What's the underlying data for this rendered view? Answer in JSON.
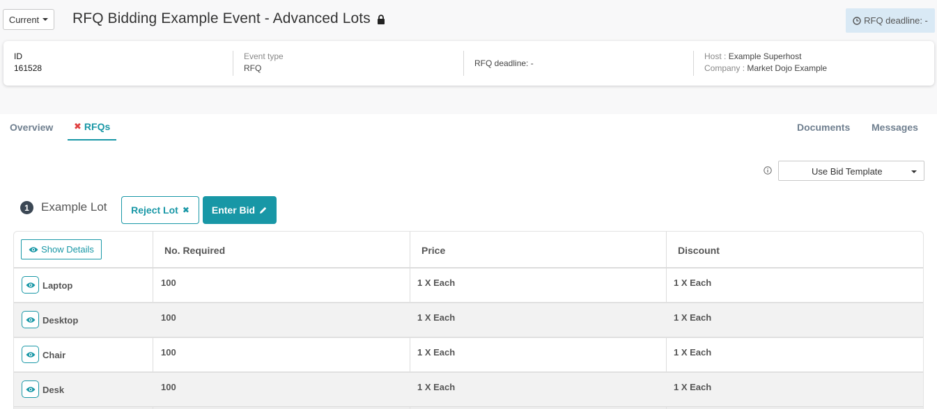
{
  "header": {
    "version_label": "Current",
    "event_title": "RFQ Bidding Example Event - Advanced Lots",
    "deadline_pill": "RFQ deadline: -"
  },
  "info": {
    "id_label": "ID",
    "id_value": "161528",
    "event_type_label": "Event type",
    "event_type_value": "RFQ",
    "deadline_text": "RFQ deadline: -",
    "host_label": "Host :",
    "host_value": "Example Superhost",
    "company_label": "Company :",
    "company_value": "Market Dojo Example"
  },
  "tabs": {
    "overview": "Overview",
    "rfqs": "RFQs",
    "documents": "Documents",
    "messages": "Messages"
  },
  "template": {
    "label": "Use Bid Template"
  },
  "lot": {
    "number": "1",
    "name": "Example Lot",
    "reject_label": "Reject Lot",
    "enter_label": "Enter Bid"
  },
  "table": {
    "show_details": "Show Details",
    "headers": [
      "No. Required",
      "Price",
      "Discount"
    ],
    "rows": [
      {
        "name": "Laptop",
        "required": "100",
        "price": "1 X Each",
        "discount": "1 X Each"
      },
      {
        "name": "Desktop",
        "required": "100",
        "price": "1 X Each",
        "discount": "1 X Each"
      },
      {
        "name": "Chair",
        "required": "100",
        "price": "1 X Each",
        "discount": "1 X Each"
      },
      {
        "name": "Desk",
        "required": "100",
        "price": "1 X Each",
        "discount": "1 X Each"
      }
    ]
  },
  "colors": {
    "accent": "#1897a6",
    "reject_icon": "#e04040",
    "pill_bg": "#d9e9f5",
    "lot_badge": "#3b4754"
  }
}
